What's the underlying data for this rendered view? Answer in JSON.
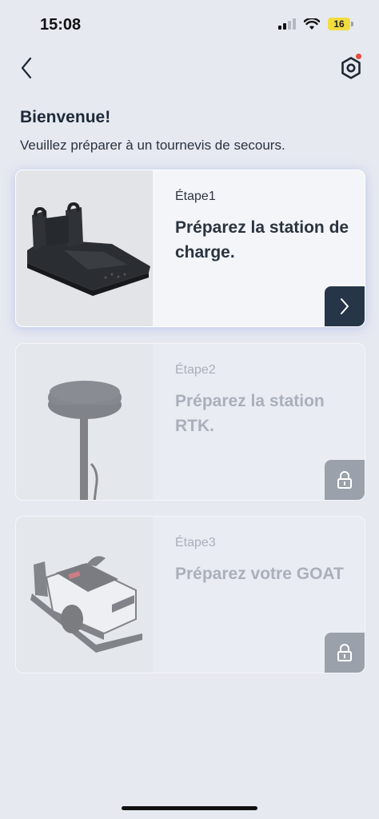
{
  "status_bar": {
    "time": "15:08",
    "battery_level": "16",
    "icons": [
      "cellular-signal-icon",
      "wifi-icon",
      "battery-icon"
    ]
  },
  "nav": {
    "back_icon": "chevron-left-icon",
    "settings_icon": "settings-gear-icon",
    "settings_has_notification": true
  },
  "header": {
    "title": "Bienvenue!",
    "subtitle": "Veuillez préparer à un tournevis de secours."
  },
  "steps": [
    {
      "step": "Étape1",
      "title": "Préparez la station de charge.",
      "state": "active",
      "action_icon": "chevron-right-icon",
      "image": "charging-station-image"
    },
    {
      "step": "Étape2",
      "title": "Préparez la station RTK.",
      "state": "locked",
      "action_icon": "lock-icon",
      "image": "rtk-antenna-image"
    },
    {
      "step": "Étape3",
      "title": "Préparez votre GOAT",
      "state": "locked",
      "action_icon": "lock-icon",
      "image": "robot-mower-image"
    }
  ],
  "colors": {
    "background": "#e6e9f0",
    "active_action": "#263547",
    "locked_action": "#9aa1ab",
    "notification_dot": "#e84a3c",
    "battery": "#f2dc3f"
  }
}
